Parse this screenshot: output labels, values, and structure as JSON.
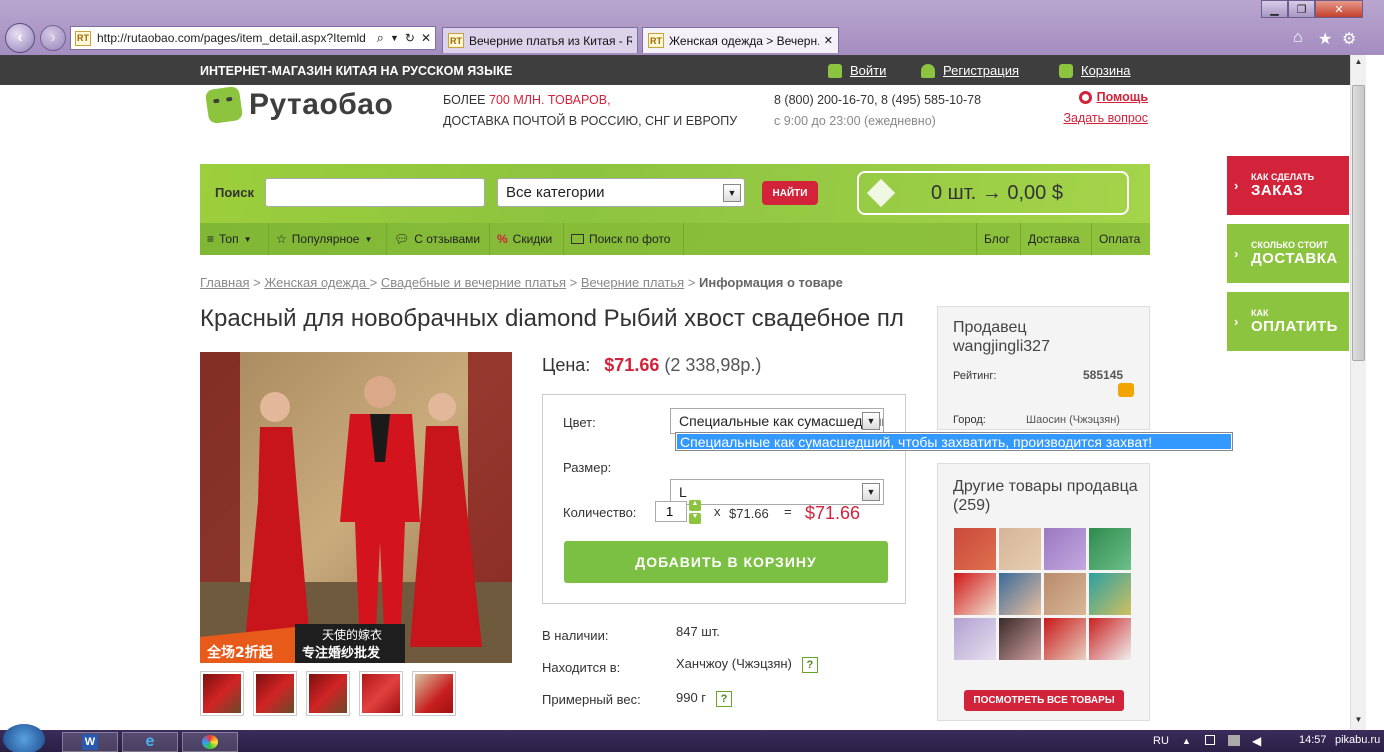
{
  "browser": {
    "url": "http://rutaobao.com/pages/item_detail.aspx?Itemld",
    "tabs": [
      {
        "label": "Вечерние платья из Китая - R..."
      },
      {
        "label": "Женская одежда > Вечерн..."
      }
    ],
    "rt_label": "RT"
  },
  "topbar": {
    "slogan": "ИНТЕРНЕТ-МАГАЗИН КИТАЯ НА РУССКОМ ЯЗЫКЕ",
    "login": "Войти",
    "register": "Регистрация",
    "cart": "Корзина"
  },
  "header": {
    "logo": "Рутаобао",
    "tagline_prefix": "БОЛЕЕ ",
    "tagline_highlight": "700 МЛН. ТОВАРОВ,",
    "tagline_line2": "ДОСТАВКА ПОЧТОЙ В РОССИЮ, СНГ И ЕВРОПУ",
    "phones": "8 (800) 200-16-70, 8 (495) 585-10-78",
    "hours": "с 9:00 до 23:00 (ежедневно)",
    "help": "Помощь",
    "ask": "Задать вопрос"
  },
  "search": {
    "label": "Поиск",
    "value": "",
    "category": "Все категории",
    "button": "НАЙТИ",
    "cart_summary": "0 шт. → 0,00 $"
  },
  "nav": {
    "left": [
      "Топ",
      "Популярное",
      "С отзывами",
      "Скидки",
      "Поиск по фото"
    ],
    "right": [
      "Блог",
      "Доставка",
      "Оплата"
    ]
  },
  "breadcrumb": {
    "items": [
      "Главная",
      "Женская одежда ",
      "Свадебные и вечерние платья",
      "Вечерние платья"
    ],
    "current": "Информация о товаре",
    "sep": " > "
  },
  "product": {
    "title": "Красный для новобрачных diamond Рыбий хвост свадебное платье",
    "price_label": "Цена:",
    "price": "$71.66",
    "price_rub": "(2 338,98р.)",
    "color_label": "Цвет:",
    "color_value": "Специальные как сумасшедший, чтобы захватить, производится захват!",
    "color_tooltip": "Специальные как сумасшедший, чтобы захватить, производится захват!",
    "size_label": "Размер:",
    "size_value": "L",
    "qty_label": "Количество:",
    "qty_value": "1",
    "qty_times": "x",
    "qty_unit_price": "$71.66",
    "qty_eq": "=",
    "qty_total": "$71.66",
    "add_to_cart": "ДОБАВИТЬ В КОРЗИНУ",
    "stock_label": "В наличии:",
    "stock_value": "847 шт.",
    "location_label": "Находится в:",
    "location_value": "Ханчжоу (Чжэцзян)",
    "weight_label": "Примерный вес:",
    "weight_value": "990 г",
    "banner_line1": "天使的嫁衣",
    "banner_line2": "专注婚纱批发",
    "banner_badge": "全场2折起"
  },
  "seller": {
    "title": "Продавец",
    "name": "wangjingli327",
    "rating_label": "Рейтинг:",
    "rating": "585145",
    "city_label": "Город:",
    "city": "Шаосин (Чжэцзян)",
    "others_title": "Другие товары продавца (259)",
    "view_all": "ПОСМОТРЕТЬ ВСЕ ТОВАРЫ"
  },
  "float_tabs": [
    {
      "small": "КАК СДЕЛАТЬ",
      "big": "ЗАКАЗ",
      "color": "#d3233a"
    },
    {
      "small": "СКОЛЬКО СТОИТ",
      "big": "ДОСТАВКА",
      "color": "#8cc33f"
    },
    {
      "small": "КАК",
      "big": "ОПЛАТИТЬ",
      "color": "#8cc33f"
    }
  ],
  "taskbar": {
    "lang": "RU",
    "time": "14:57",
    "watermark": "pikabu.ru"
  },
  "colors": {
    "brand_green": "#8cc33f",
    "brand_red": "#d3233a",
    "dark": "#3e3e3e"
  }
}
